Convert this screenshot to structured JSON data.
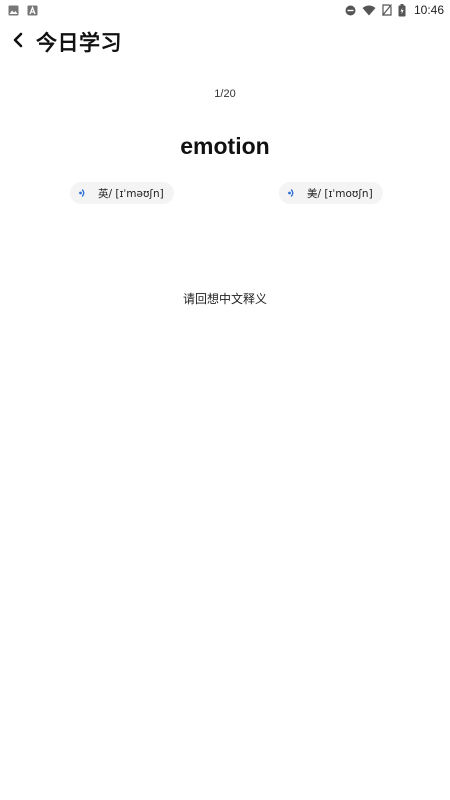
{
  "status_bar": {
    "time": "10:46",
    "left_icons": [
      "image-icon",
      "text-a-icon"
    ],
    "right_icons": [
      "do-not-disturb-icon",
      "wifi-icon",
      "no-sim-icon",
      "battery-icon"
    ]
  },
  "header": {
    "back_icon": "chevron-left-icon",
    "title": "今日学习"
  },
  "progress": "1/20",
  "word": "emotion",
  "pronunciations": {
    "uk": {
      "label": "英/ [ɪˈməʊʃn]",
      "icon": "speaker-icon"
    },
    "us": {
      "label": "美/ [ɪˈmoʊʃn]",
      "icon": "speaker-icon"
    }
  },
  "hint": "请回想中文释义",
  "colors": {
    "speaker_accent": "#2f6fd6",
    "pill_background": "#f4f4f4"
  }
}
